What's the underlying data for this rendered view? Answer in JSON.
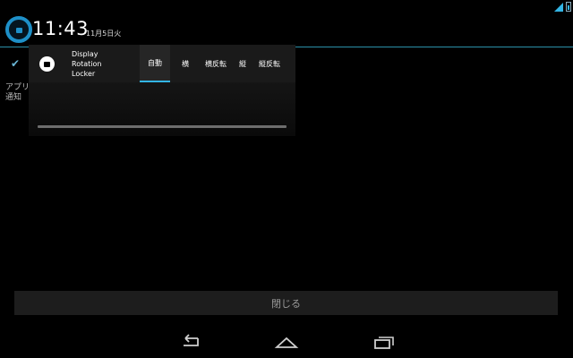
{
  "status_bar": {
    "icons": [
      "signal-icon",
      "battery-icon"
    ]
  },
  "header": {
    "time": "11:43",
    "date": "11月5日火"
  },
  "background_app": {
    "logo": "lock-rotation-icon",
    "line1": "アプリ",
    "line2": "通知"
  },
  "notification": {
    "app_icon": "lock-icon",
    "title_line1": "Display",
    "title_line2": "Rotation",
    "title_line3": "Locker",
    "tabs": [
      {
        "label": "自動",
        "active": true
      },
      {
        "label": "横",
        "active": false
      },
      {
        "label": "横反転",
        "active": false
      },
      {
        "label": "縦",
        "active": false
      },
      {
        "label": "縦反転",
        "active": false
      }
    ]
  },
  "close_button": {
    "label": "閉じる"
  },
  "nav_bar": {
    "back": "back-icon",
    "home": "home-icon",
    "recents": "recents-icon"
  },
  "colors": {
    "accent": "#33b5e5",
    "background": "#000000",
    "panel": "#1a1a1a"
  }
}
